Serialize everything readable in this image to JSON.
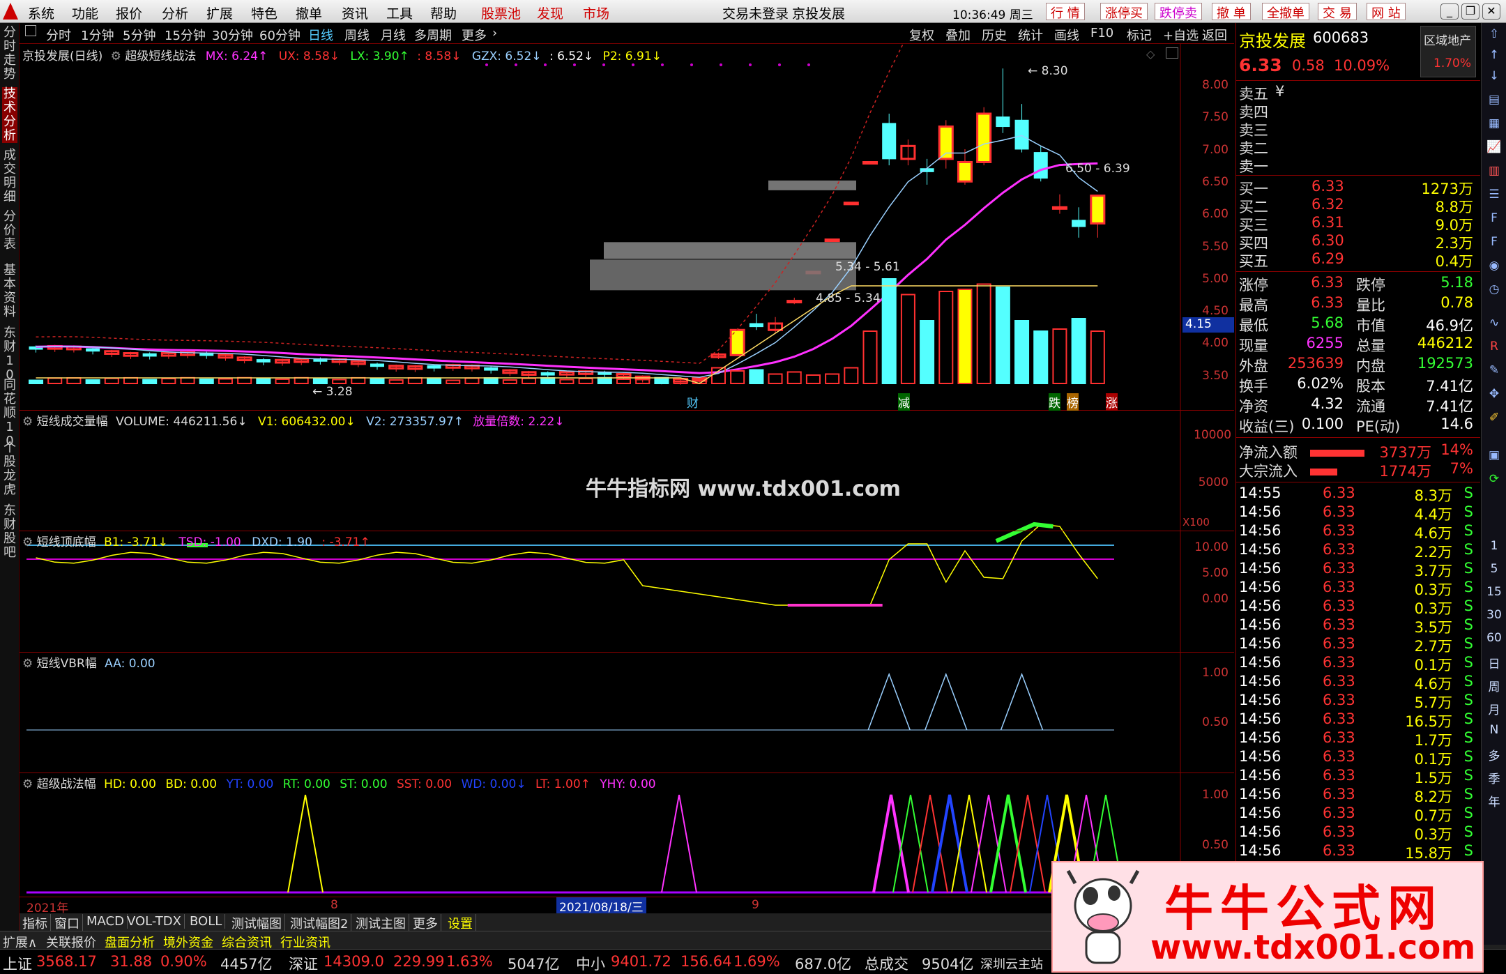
{
  "menubar": {
    "items": [
      "系统",
      "功能",
      "报价",
      "分析",
      "扩展",
      "特色",
      "撤单",
      "资讯",
      "工具",
      "帮助"
    ],
    "hot_items": [
      "股票池",
      "发现",
      "市场"
    ],
    "login": "交易未登录",
    "stock": "京投发展",
    "time": "10:36:49 周三",
    "right_buttons": [
      "行 情",
      "涨停买",
      "跌停卖",
      "撤 单",
      "全撤单",
      "交 易",
      "网 站"
    ]
  },
  "leftnav": [
    "分时走势",
    "技术分析",
    "成交明细",
    "分价表",
    "基本资料",
    "东财10",
    "同花顺10",
    "个股龙虎",
    "东财股吧"
  ],
  "toolbar": {
    "periods": [
      "分时",
      "1分钟",
      "5分钟",
      "15分钟",
      "30分钟",
      "60分钟",
      "日线",
      "周线",
      "月线",
      "多周期",
      "更多"
    ],
    "active_period": "日线",
    "tools": [
      "复权",
      "叠加",
      "历史",
      "统计",
      "画线",
      "F10",
      "标记",
      "+自选",
      "返回"
    ]
  },
  "main_title": {
    "name": "京投发展(日线)",
    "formula": "超级短线战法",
    "items": [
      "MX: 6.24↑",
      "UX: 8.58↓",
      "LX: 3.90↑",
      ": 8.58↓",
      "GZX: 6.52↓",
      ": 6.52↓",
      "P2: 6.91↓"
    ]
  },
  "main_axis": [
    "8.00",
    "7.50",
    "7.00",
    "6.50",
    "6.00",
    "5.50",
    "5.00",
    "4.50",
    "4.00",
    "3.50"
  ],
  "price_box": "4.15",
  "main_labels": {
    "high": "8.30",
    "low": "3.28",
    "zone1": "6.50 - 6.39",
    "zone2": "5.34 - 5.61",
    "zone3": "4.85 - 5.34",
    "marks": [
      "财",
      "减",
      "跌",
      "榜",
      "涨"
    ]
  },
  "vol_title": {
    "name": "短线成交量幅",
    "items": [
      "VOLUME: 446211.56↓",
      "V1: 606432.00↓",
      "V2: 273357.97↑",
      "放量倍数: 2.22↓"
    ]
  },
  "vol_axis": [
    "10000",
    "5000"
  ],
  "vol_unit": "X100",
  "vol_watermark": "牛牛指标网 www.tdx001.com",
  "top_title": {
    "name": "短线顶底幅",
    "items": [
      "B1: -3.71↓",
      "TSD: -1.00",
      "DXD: 1.90",
      ": -3.71↑"
    ]
  },
  "top_axis": [
    "10.00",
    "5.00",
    "0.00"
  ],
  "vbr_title": {
    "name": "短线VBR幅",
    "items": [
      "AA: 0.00"
    ]
  },
  "vbr_axis": [
    "1.00",
    "0.50"
  ],
  "sup_title": {
    "name": "超级战法幅",
    "items": [
      "HD: 0.00",
      "BD: 0.00",
      "YT: 0.00",
      "RT: 0.00",
      "ST: 0.00",
      "SST: 0.00",
      "WD: 0.00↓",
      "LT: 1.00↑",
      "YHY: 0.00"
    ]
  },
  "sup_axis": [
    "1.00",
    "0.50"
  ],
  "date_bar": {
    "year": "2021年",
    "m1": "8",
    "cursor": "2021/08/18/三",
    "m2": "9"
  },
  "bottom_tabs": [
    "指标",
    "窗口",
    "MACD",
    "VOL-TDX",
    "BOLL",
    "测试幅图",
    "测试幅图2",
    "测试主图",
    "更多",
    "设置"
  ],
  "bottom_menu": [
    "扩展∧",
    "关联报价",
    "盘面分析",
    "境外资金",
    "综合资讯",
    "行业资讯"
  ],
  "status": [
    {
      "name": "上证",
      "price": "3568.17",
      "chg": "31.88",
      "pct": "0.90%",
      "amt": "4457亿"
    },
    {
      "name": "深证",
      "price": "14309.0",
      "chg": "229.99",
      "pct": "1.63%",
      "amt": "5047亿"
    },
    {
      "name": "中小",
      "price": "9401.72",
      "chg": "156.64",
      "pct": "1.69%",
      "amt": "687.0亿"
    }
  ],
  "status_total_label": "总成交",
  "status_total": "9504亿",
  "status_site": "深圳云主站",
  "quote": {
    "name": "京投发展",
    "code": "600683",
    "sector": "区域地产",
    "sector_pct": "1.70%",
    "price": "6.33",
    "chg": "0.58",
    "pct": "10.09%",
    "asks": [
      "卖五",
      "卖四",
      "卖三",
      "卖二",
      "卖一"
    ],
    "ask_mark": "¥",
    "bids": [
      {
        "l": "买一",
        "p": "6.33",
        "v": "1273万"
      },
      {
        "l": "买二",
        "p": "6.32",
        "v": "8.8万"
      },
      {
        "l": "买三",
        "p": "6.31",
        "v": "9.0万"
      },
      {
        "l": "买四",
        "p": "6.30",
        "v": "2.3万"
      },
      {
        "l": "买五",
        "p": "6.29",
        "v": "0.4万"
      }
    ],
    "stats": [
      {
        "a": "涨停",
        "b": "6.33",
        "c": "跌停",
        "d": "5.18"
      },
      {
        "a": "最高",
        "b": "6.33",
        "c": "量比",
        "d": "0.78"
      },
      {
        "a": "最低",
        "b": "5.68",
        "c": "市值",
        "d": "46.9亿"
      },
      {
        "a": "现量",
        "b": "6255",
        "c": "总量",
        "d": "446212"
      },
      {
        "a": "外盘",
        "b": "253639",
        "c": "内盘",
        "d": "192573"
      },
      {
        "a": "换手",
        "b": "6.02%",
        "c": "股本",
        "d": "7.41亿"
      },
      {
        "a": "净资",
        "b": "4.32",
        "c": "流通",
        "d": "7.41亿"
      },
      {
        "a": "收益(三)",
        "b": "0.100",
        "c": "PE(动)",
        "d": "14.6"
      }
    ],
    "flows": [
      {
        "l": "净流入额",
        "v": "3737万",
        "p": "14%",
        "f": 0.14
      },
      {
        "l": "大宗流入",
        "v": "1774万",
        "p": "7%",
        "f": 0.07
      }
    ],
    "ticks": [
      {
        "t": "14:55",
        "p": "6.33",
        "v": "8.3万",
        "s": "S"
      },
      {
        "t": "14:56",
        "p": "6.33",
        "v": "4.4万",
        "s": "S"
      },
      {
        "t": "14:56",
        "p": "6.33",
        "v": "4.6万",
        "s": "S"
      },
      {
        "t": "14:56",
        "p": "6.33",
        "v": "2.2万",
        "s": "S"
      },
      {
        "t": "14:56",
        "p": "6.33",
        "v": "3.7万",
        "s": "S"
      },
      {
        "t": "14:56",
        "p": "6.33",
        "v": "0.3万",
        "s": "S"
      },
      {
        "t": "14:56",
        "p": "6.33",
        "v": "0.3万",
        "s": "S"
      },
      {
        "t": "14:56",
        "p": "6.33",
        "v": "3.5万",
        "s": "S"
      },
      {
        "t": "14:56",
        "p": "6.33",
        "v": "2.7万",
        "s": "S"
      },
      {
        "t": "14:56",
        "p": "6.33",
        "v": "0.1万",
        "s": "S"
      },
      {
        "t": "14:56",
        "p": "6.33",
        "v": "4.6万",
        "s": "S"
      },
      {
        "t": "14:56",
        "p": "6.33",
        "v": "5.7万",
        "s": "S"
      },
      {
        "t": "14:56",
        "p": "6.33",
        "v": "16.5万",
        "s": "S"
      },
      {
        "t": "14:56",
        "p": "6.33",
        "v": "1.7万",
        "s": "S"
      },
      {
        "t": "14:56",
        "p": "6.33",
        "v": "0.1万",
        "s": "S"
      },
      {
        "t": "14:56",
        "p": "6.33",
        "v": "1.5万",
        "s": "S"
      },
      {
        "t": "14:56",
        "p": "6.33",
        "v": "8.2万",
        "s": "S"
      },
      {
        "t": "14:56",
        "p": "6.33",
        "v": "0.7万",
        "s": "S"
      },
      {
        "t": "14:56",
        "p": "6.33",
        "v": "0.3万",
        "s": "S"
      },
      {
        "t": "14:56",
        "p": "6.33",
        "v": "15.8万",
        "s": "S"
      }
    ]
  },
  "rtools": [
    "1",
    "5",
    "15",
    "30",
    "60",
    "日",
    "周",
    "月",
    "N",
    "多",
    "季",
    "年"
  ],
  "watermark": {
    "title": "牛牛公式网",
    "url": "www.tdx001.com"
  },
  "colors": {
    "up": "#ff3030",
    "down": "#54ffff",
    "ma_slow": "#ff30ff",
    "ma_fast": "#9ad0ff",
    "axis": "#cc3333",
    "limit_up": "#ffff00"
  }
}
